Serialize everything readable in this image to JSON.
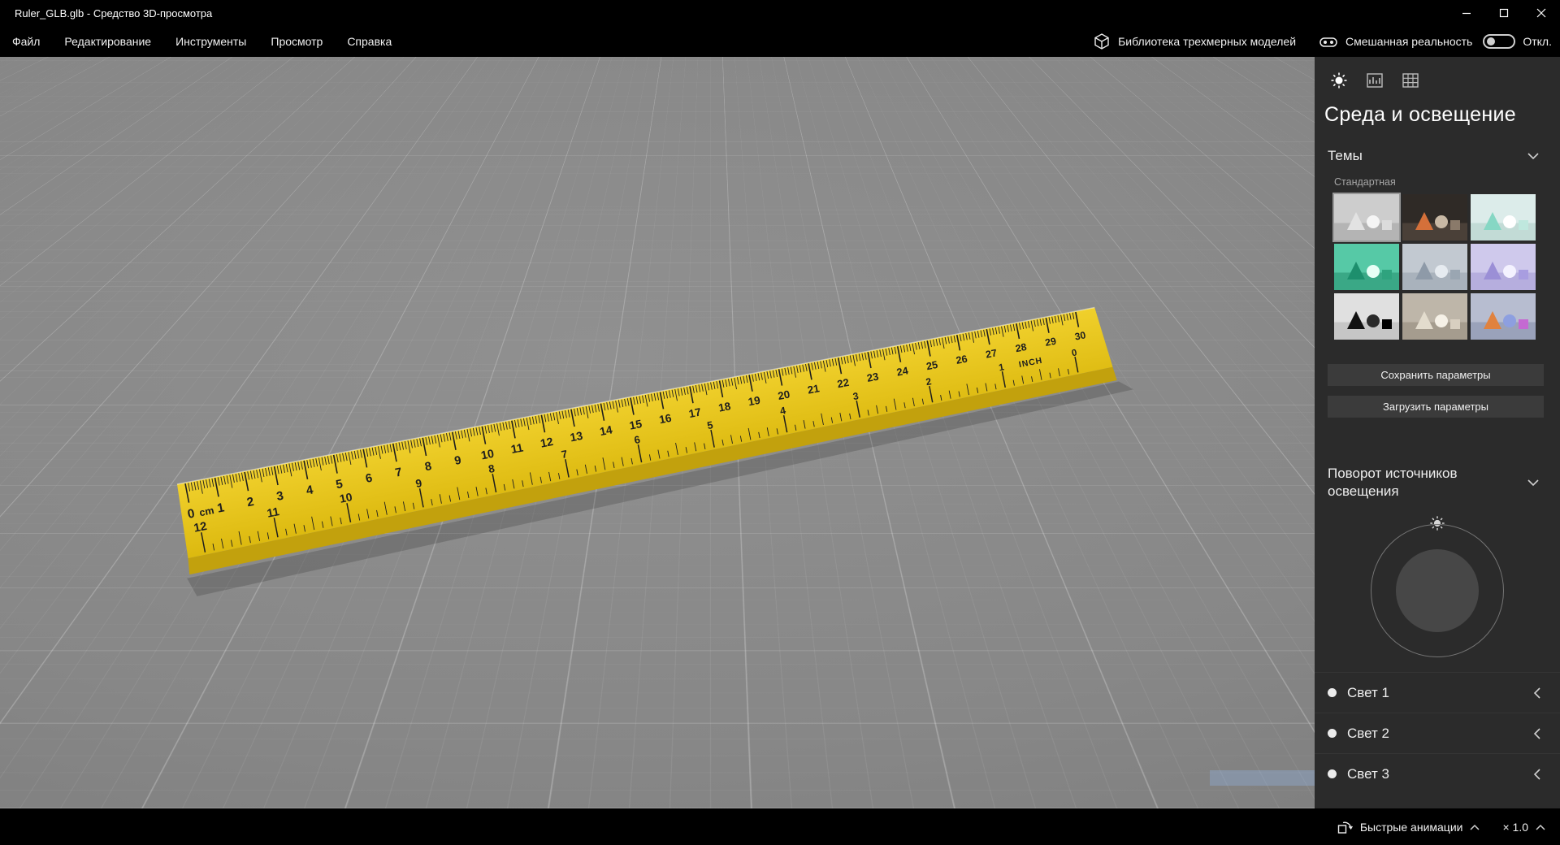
{
  "window": {
    "title": "Ruler_GLB.glb - Средство 3D-просмотра"
  },
  "menubar": {
    "items": [
      "Файл",
      "Редактирование",
      "Инструменты",
      "Просмотр",
      "Справка"
    ],
    "library_label": "Библиотека трехмерных моделей",
    "mixed_reality_label": "Смешанная реальность",
    "mixed_reality_state": "Откл."
  },
  "panel": {
    "title": "Среда и освещение",
    "themes": {
      "section_label": "Темы",
      "group_label": "Стандартная",
      "selected_index": 0,
      "items": [
        {
          "name": "default-light-gray",
          "sky": "#cdcdcd",
          "ground": "#b4b4b4",
          "cone": "#e2e2e2",
          "sphere": "#f5f5f5",
          "cube": "#dcdcdc"
        },
        {
          "name": "dark-amber",
          "sky": "#2f2a26",
          "ground": "#4a4038",
          "cone": "#d4703a",
          "sphere": "#c9b9a5",
          "cube": "#8a7a6a"
        },
        {
          "name": "mint",
          "sky": "#dcecea",
          "ground": "#c2dbd6",
          "cone": "#86d7c4",
          "sphere": "#ffffff",
          "cube": "#bfe8de"
        },
        {
          "name": "teal-green",
          "sky": "#56c9a6",
          "ground": "#3aa886",
          "cone": "#1d8f6d",
          "sphere": "#e8fff6",
          "cube": "#2fa37e"
        },
        {
          "name": "cool-gray",
          "sky": "#c2c9d1",
          "ground": "#a9b2bc",
          "cone": "#8e9aa8",
          "sphere": "#e6ebf0",
          "cube": "#9aa6b2"
        },
        {
          "name": "lavender",
          "sky": "#cfc9ec",
          "ground": "#b6aede",
          "cone": "#9b8fd6",
          "sphere": "#f4f2ff",
          "cube": "#a89de0"
        },
        {
          "name": "black-white",
          "sky": "#e0e0e0",
          "ground": "#c6c6c6",
          "cone": "#111111",
          "sphere": "#2a2a2a",
          "cube": "#000000"
        },
        {
          "name": "warm-gray",
          "sky": "#beb6a9",
          "ground": "#a59c8e",
          "cone": "#e3dccd",
          "sphere": "#f6f1e7",
          "cube": "#d8cfc0"
        },
        {
          "name": "multicolor",
          "sky": "#b7bdd0",
          "ground": "#9aa2ba",
          "cone": "#e0823f",
          "sphere": "#8d9fe0",
          "cube": "#c46ad2"
        }
      ]
    },
    "save_button": "Сохранить параметры",
    "load_button": "Загрузить параметры",
    "rotation_section_label": "Поворот источников освещения",
    "lights": [
      {
        "label": "Свет 1"
      },
      {
        "label": "Свет 2"
      },
      {
        "label": "Свет 3"
      }
    ]
  },
  "bottombar": {
    "quick_animations_label": "Быстрые анимации",
    "speed_label": "× 1.0"
  },
  "viewport": {
    "ruler": {
      "body_color_top": "#f0d02c",
      "body_color_bottom": "#dcb90f",
      "edge_color": "#c2a10d",
      "tick_color": "#1e1e1e",
      "cm_unit_label": "cm",
      "inch_unit_label": "INCH",
      "cm_numbers": [
        0,
        1,
        2,
        3,
        4,
        5,
        6,
        7,
        8,
        9,
        10,
        11,
        12,
        13,
        14,
        15,
        16,
        17,
        18,
        19,
        20,
        21,
        22,
        23,
        24,
        25,
        26,
        27,
        28,
        29,
        30
      ],
      "inch_numbers": [
        12,
        11,
        10,
        9,
        8,
        7,
        6,
        5,
        4,
        3,
        2,
        1,
        0
      ]
    },
    "grid_color": "#8a8a8a"
  }
}
